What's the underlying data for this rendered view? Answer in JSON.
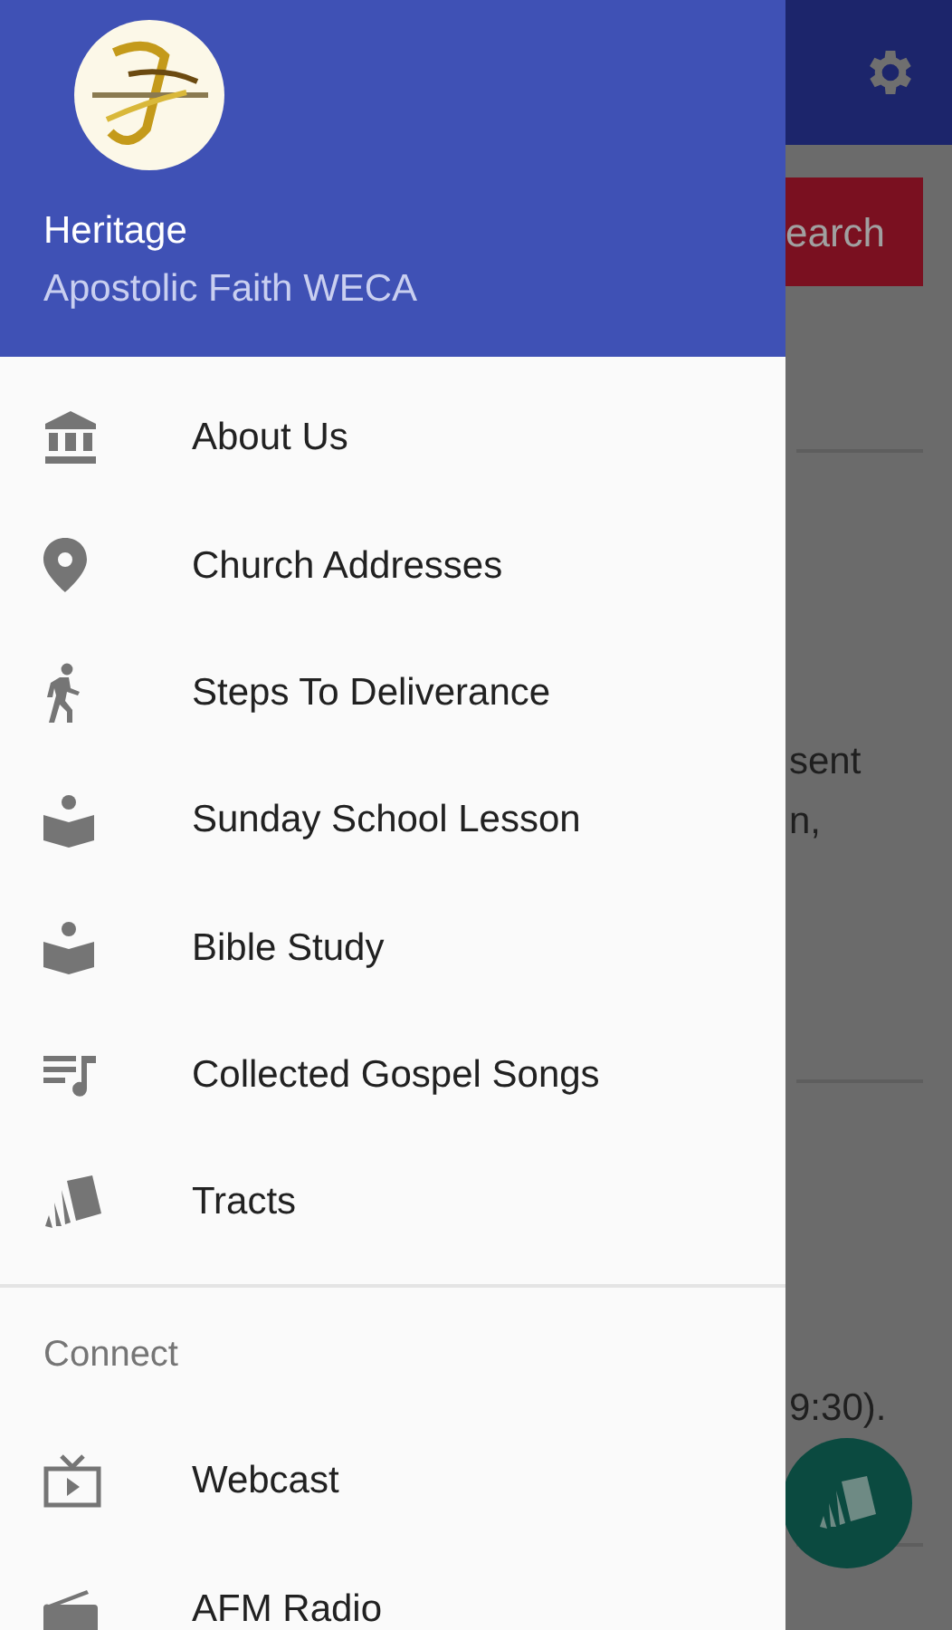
{
  "drawer": {
    "header": {
      "title": "Heritage",
      "subtitle": "Apostolic Faith WECA"
    },
    "items": [
      {
        "label": "About Us",
        "kind": "bank"
      },
      {
        "label": "Church Addresses",
        "kind": "pin"
      },
      {
        "label": "Steps To Deliverance",
        "kind": "walk"
      },
      {
        "label": "Sunday School Lesson",
        "kind": "reader"
      },
      {
        "label": "Bible Study",
        "kind": "reader"
      },
      {
        "label": "Collected Gospel Songs",
        "kind": "playlist"
      },
      {
        "label": "Tracts",
        "kind": "cards"
      }
    ],
    "sections": [
      {
        "title": "Connect",
        "items": [
          {
            "label": "Webcast",
            "kind": "tv"
          },
          {
            "label": "AFM Radio",
            "kind": "radio"
          }
        ]
      }
    ]
  },
  "background": {
    "search_button": "earch",
    "texts": [
      "sent",
      "n,",
      "9:30)."
    ]
  }
}
